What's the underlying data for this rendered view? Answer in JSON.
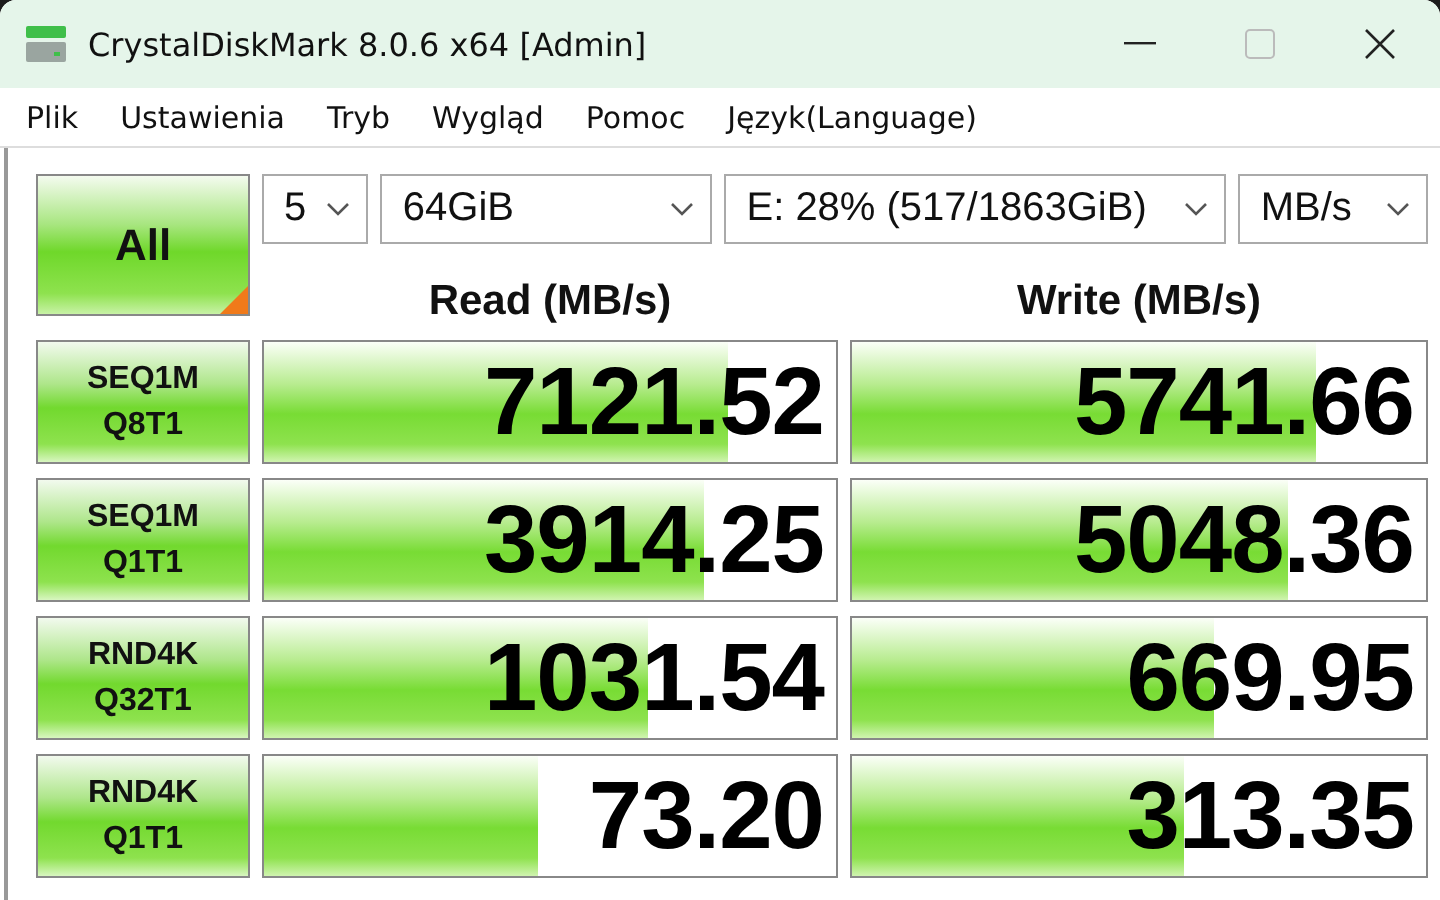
{
  "window": {
    "title": "CrystalDiskMark 8.0.6 x64 [Admin]"
  },
  "menu": [
    "Plik",
    "Ustawienia",
    "Tryb",
    "Wygląd",
    "Pomoc",
    "Język(Language)"
  ],
  "all_button": {
    "label": "All"
  },
  "settings": {
    "count": "5",
    "size": "64GiB",
    "drive": "E: 28% (517/1863GiB)",
    "unit": "MB/s"
  },
  "headers": {
    "read": "Read (MB/s)",
    "write": "Write (MB/s)"
  },
  "tests": [
    {
      "line1": "SEQ1M",
      "line2": "Q8T1",
      "read": {
        "value": "7121.52",
        "level": 0.81
      },
      "write": {
        "value": "5741.66",
        "level": 0.81
      }
    },
    {
      "line1": "SEQ1M",
      "line2": "Q1T1",
      "read": {
        "value": "3914.25",
        "level": 0.77
      },
      "write": {
        "value": "5048.36",
        "level": 0.76
      }
    },
    {
      "line1": "RND4K",
      "line2": "Q32T1",
      "read": {
        "value": "1031.54",
        "level": 0.67
      },
      "write": {
        "value": "669.95",
        "level": 0.63
      }
    },
    {
      "line1": "RND4K",
      "line2": "Q1T1",
      "read": {
        "value": "73.20",
        "level": 0.48
      },
      "write": {
        "value": "313.35",
        "level": 0.58
      }
    }
  ]
}
